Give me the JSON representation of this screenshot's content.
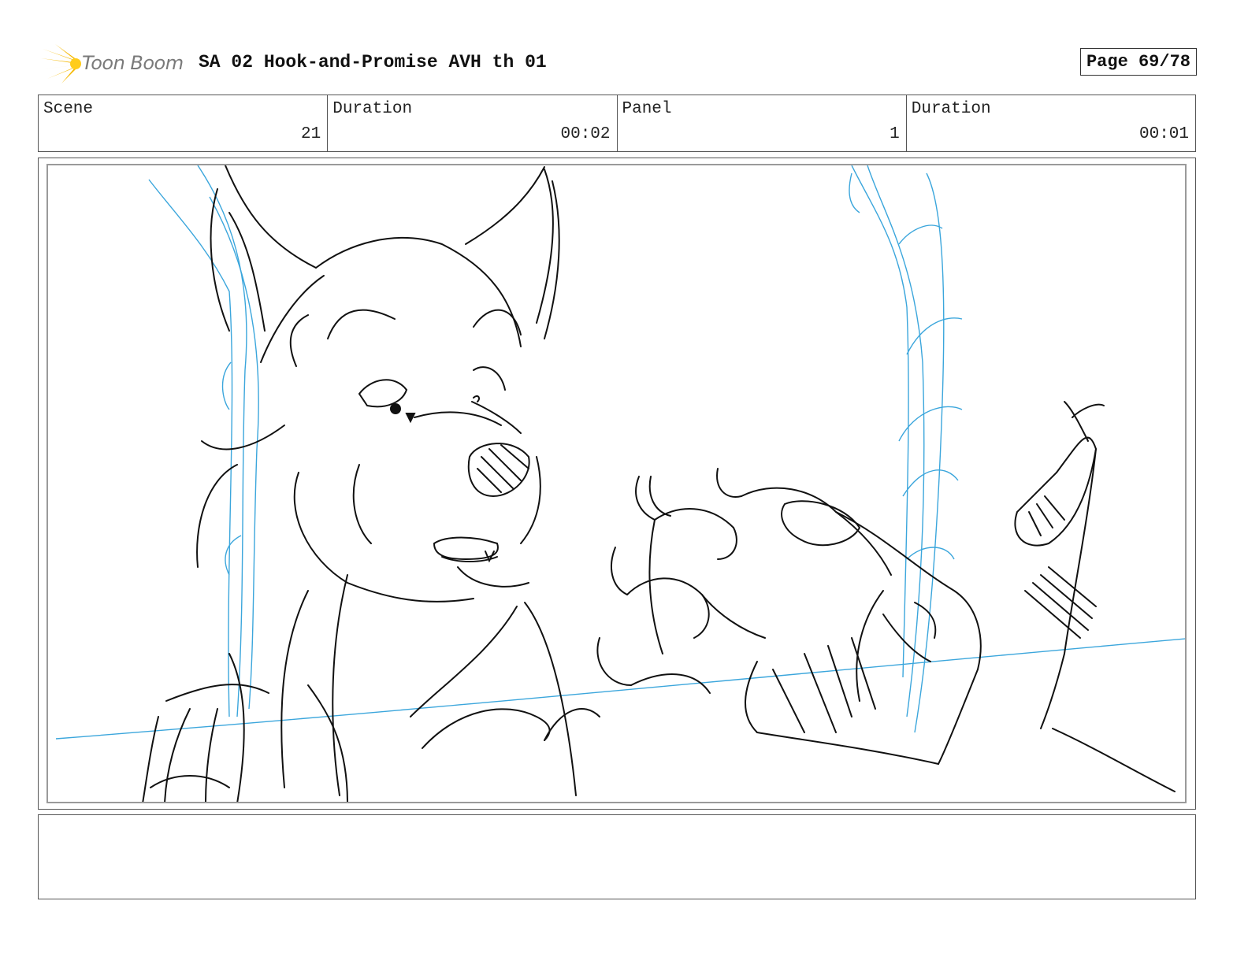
{
  "header": {
    "logo_text": "Toon Boom",
    "title": "SA 02 Hook-and-Promise AVH th 01",
    "page": "Page 69/78"
  },
  "info": {
    "scene_label": "Scene",
    "scene_value": "21",
    "scene_duration_label": "Duration",
    "scene_duration_value": "00:02",
    "panel_label": "Panel",
    "panel_value": "1",
    "panel_duration_label": "Duration",
    "panel_duration_value": "00:01"
  },
  "notes": {
    "text": ""
  },
  "colors": {
    "sketch_line": "#111111",
    "guide_line": "#3ba6dc",
    "logo_flare": "#f5b800"
  }
}
